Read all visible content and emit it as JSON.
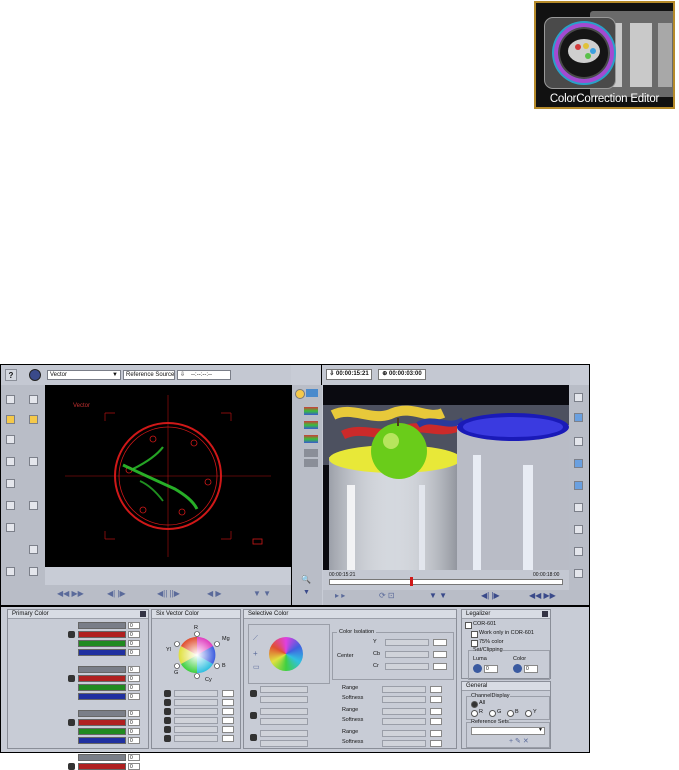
{
  "logo": {
    "caption": "ColorCorrection Editor"
  },
  "toolbar": {
    "help": "?",
    "scope_mode": "Vector",
    "reference": "Reference Source",
    "timecode_placeholder": "--:--:--:--"
  },
  "scope": {
    "label": "Vector",
    "targets": [
      "R",
      "Mg",
      "B",
      "Cy",
      "G",
      "Yl"
    ]
  },
  "player": {
    "timecode_in": "00:00:15:21",
    "timecode_dur": "00:00:03:00",
    "timecode_end": "00:00:18:00"
  },
  "primary": {
    "title": "Primary Color",
    "values": [
      "0",
      "0",
      "0",
      "0",
      "0",
      "0",
      "0",
      "0",
      "0",
      "0",
      "0",
      "0",
      "0",
      "0"
    ]
  },
  "sixvector": {
    "title": "Six Vector Color",
    "labels": [
      "R",
      "Mg",
      "B",
      "Cy",
      "G",
      "Yl"
    ]
  },
  "selective": {
    "title": "Selective Color",
    "isolation_title": "Color Isolation",
    "center": "Center",
    "y": "Y",
    "cb": "Cb",
    "cr": "Cr",
    "range": "Range",
    "softness": "Softness"
  },
  "legalizer": {
    "title": "Legalizer",
    "cor": "COR-601",
    "work_only": "Work only in COR-601",
    "pct75": "75% color",
    "satclip": "Sat/Clipping",
    "luma": "Luma",
    "color": "Color",
    "luma_val": "0",
    "color_val": "0"
  },
  "general": {
    "title": "General",
    "channel": "ChannelDisplay",
    "all": "All",
    "r": "R",
    "g": "G",
    "b": "B",
    "y": "Y",
    "refsets": "Reference Sets"
  },
  "colors": {
    "scope_trace": "#2ecc2e",
    "scope_circle": "#d01818",
    "frame": "#000000"
  }
}
